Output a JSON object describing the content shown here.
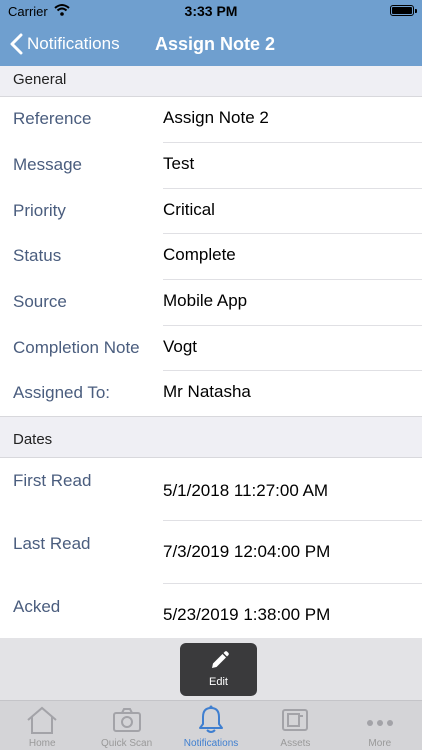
{
  "status_bar": {
    "carrier": "Carrier",
    "time": "3:33 PM"
  },
  "nav": {
    "back_label": "Notifications",
    "title": "Assign Note 2"
  },
  "general": {
    "header": "General",
    "rows": [
      {
        "label": "Reference",
        "value": "Assign Note 2"
      },
      {
        "label": "Message",
        "value": "Test"
      },
      {
        "label": "Priority",
        "value": "Critical"
      },
      {
        "label": "Status",
        "value": "Complete"
      },
      {
        "label": "Source",
        "value": "Mobile App"
      },
      {
        "label": "Completion Note",
        "value": "Vogt"
      },
      {
        "label": "Assigned To:",
        "value": "Mr Natasha"
      }
    ]
  },
  "dates": {
    "header": "Dates",
    "rows": [
      {
        "label": "First Read",
        "value": "5/1/2018 11:27:00 AM"
      },
      {
        "label": "Last Read",
        "value": "7/3/2019 12:04:00 PM"
      },
      {
        "label": "Acked",
        "value": "5/23/2019 1:38:00 PM"
      }
    ]
  },
  "edit_button": {
    "label": "Edit",
    "icon": "pencil-icon"
  },
  "tabs": [
    {
      "label": "Home",
      "icon": "house-icon",
      "active": false
    },
    {
      "label": "Quick Scan",
      "icon": "camera-icon",
      "active": false
    },
    {
      "label": "Notifications",
      "icon": "bell-icon",
      "active": true
    },
    {
      "label": "Assets",
      "icon": "box-icon",
      "active": false
    },
    {
      "label": "More",
      "icon": "more-icon",
      "active": false
    }
  ],
  "colors": {
    "nav": "#6f9fcf",
    "label": "#4a5d7e",
    "active_tab": "#3f7fd0",
    "inactive_tab": "#999999",
    "edit_button": "#3a3a3c"
  }
}
